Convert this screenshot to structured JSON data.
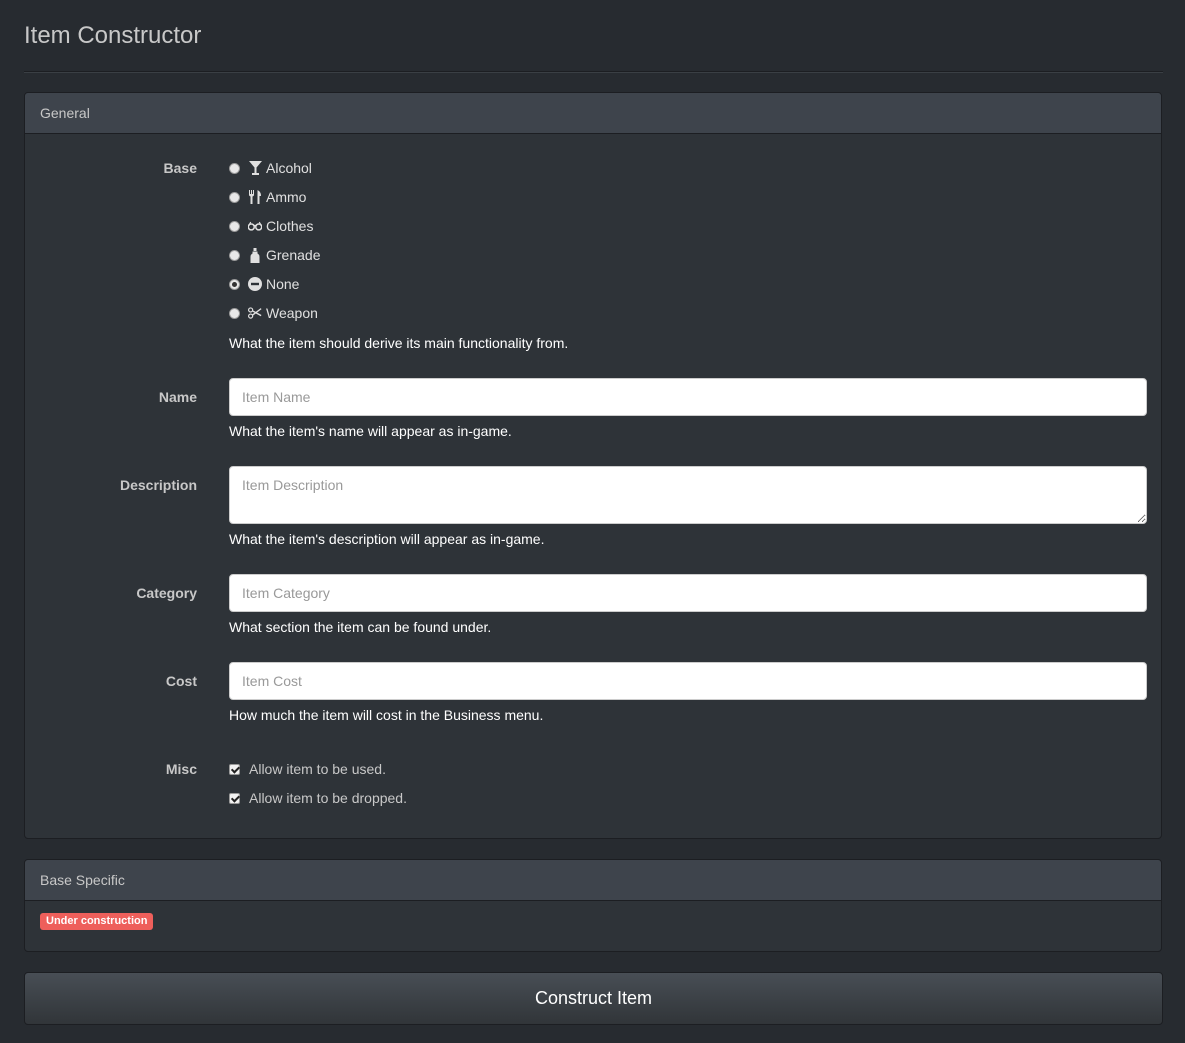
{
  "page": {
    "title": "Item Constructor"
  },
  "general": {
    "heading": "General",
    "base": {
      "label": "Base",
      "options": [
        {
          "label": "Alcohol",
          "icon": "glass-icon",
          "checked": false
        },
        {
          "label": "Ammo",
          "icon": "cutlery-icon",
          "checked": false
        },
        {
          "label": "Clothes",
          "icon": "sunglasses-icon",
          "checked": false
        },
        {
          "label": "Grenade",
          "icon": "bottle-icon",
          "checked": false
        },
        {
          "label": "None",
          "icon": "minus-circle-icon",
          "checked": true
        },
        {
          "label": "Weapon",
          "icon": "scissors-icon",
          "checked": false
        }
      ],
      "help": "What the item should derive its main functionality from."
    },
    "name": {
      "label": "Name",
      "placeholder": "Item Name",
      "value": "",
      "help": "What the item's name will appear as in-game."
    },
    "description": {
      "label": "Description",
      "placeholder": "Item Description",
      "value": "",
      "help": "What the item's description will appear as in-game."
    },
    "category": {
      "label": "Category",
      "placeholder": "Item Category",
      "value": "",
      "help": "What section the item can be found under."
    },
    "cost": {
      "label": "Cost",
      "placeholder": "Item Cost",
      "value": "",
      "help": "How much the item will cost in the Business menu."
    },
    "misc": {
      "label": "Misc",
      "options": [
        {
          "label": "Allow item to be used.",
          "checked": true
        },
        {
          "label": "Allow item to be dropped.",
          "checked": true
        }
      ]
    }
  },
  "base_specific": {
    "heading": "Base Specific",
    "badge": "Under construction",
    "badge_color": "#ee5f5b"
  },
  "actions": {
    "construct_label": "Construct Item"
  }
}
